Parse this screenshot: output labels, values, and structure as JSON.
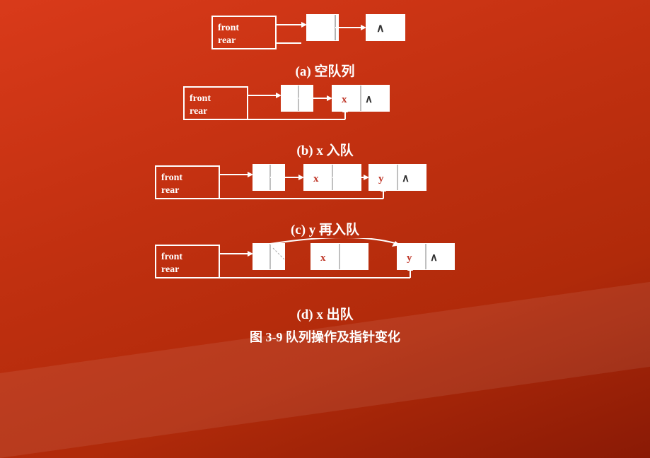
{
  "title": "队列操作及指针变化",
  "figureLabel": "图 3-9",
  "sections": [
    {
      "id": "a",
      "label": "(a)  空队列",
      "caption": "(a)  空队列"
    },
    {
      "id": "b",
      "label": "(b)   x 入队",
      "caption": "(b)   x 入队"
    },
    {
      "id": "c",
      "label": "(c)  y 再入队",
      "caption": "(c)  y 再入队"
    },
    {
      "id": "d",
      "label": "(d)    x 出队",
      "caption": "(d)    x 出队"
    }
  ],
  "figureCaption": "图 3-9    队列操作及指针变化"
}
